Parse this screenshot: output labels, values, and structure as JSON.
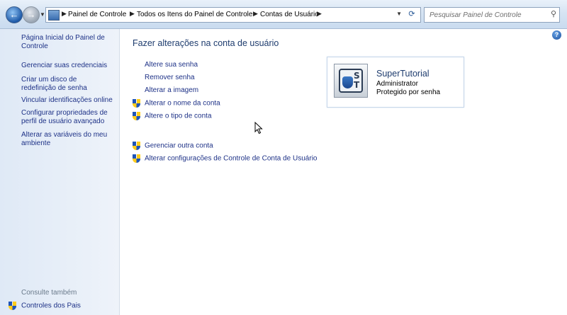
{
  "address_bar": {
    "breadcrumbs": [
      "Painel de Controle",
      "Todos os Itens do Painel de Controle",
      "Contas de Usuário"
    ],
    "search_placeholder": "Pesquisar Painel de Controle"
  },
  "sidebar": {
    "items": [
      {
        "label": "Página Inicial do Painel de Controle"
      },
      {
        "label": "Gerenciar suas credenciais"
      },
      {
        "label": "Criar um disco de redefinição de senha"
      },
      {
        "label": "Vincular identificações online"
      },
      {
        "label": "Configurar propriedades de perfil de usuário avançado"
      },
      {
        "label": "Alterar as variáveis do meu ambiente"
      }
    ],
    "see_also": "Consulte também",
    "parental_controls": "Controles dos Pais"
  },
  "main": {
    "title": "Fazer alterações na conta de usuário",
    "links": [
      {
        "label": "Altere sua senha",
        "shield": false
      },
      {
        "label": "Remover senha",
        "shield": false
      },
      {
        "label": "Alterar a imagem",
        "shield": false
      },
      {
        "label": "Alterar o nome da conta",
        "shield": true
      },
      {
        "label": "Altere o tipo de conta",
        "shield": true
      }
    ],
    "other_links": [
      {
        "label": "Gerenciar outra conta",
        "shield": true
      },
      {
        "label": "Alterar configurações de Controle de Conta de Usuário",
        "shield": true
      }
    ]
  },
  "user_card": {
    "name": "SuperTutorial",
    "role": "Administrator",
    "status": "Protegido por senha",
    "avatar_letters": [
      "S",
      "T"
    ]
  },
  "colors": {
    "link": "#1e3287",
    "title": "#1e3c6e",
    "sidebar_bg": "#dfe9f6"
  }
}
